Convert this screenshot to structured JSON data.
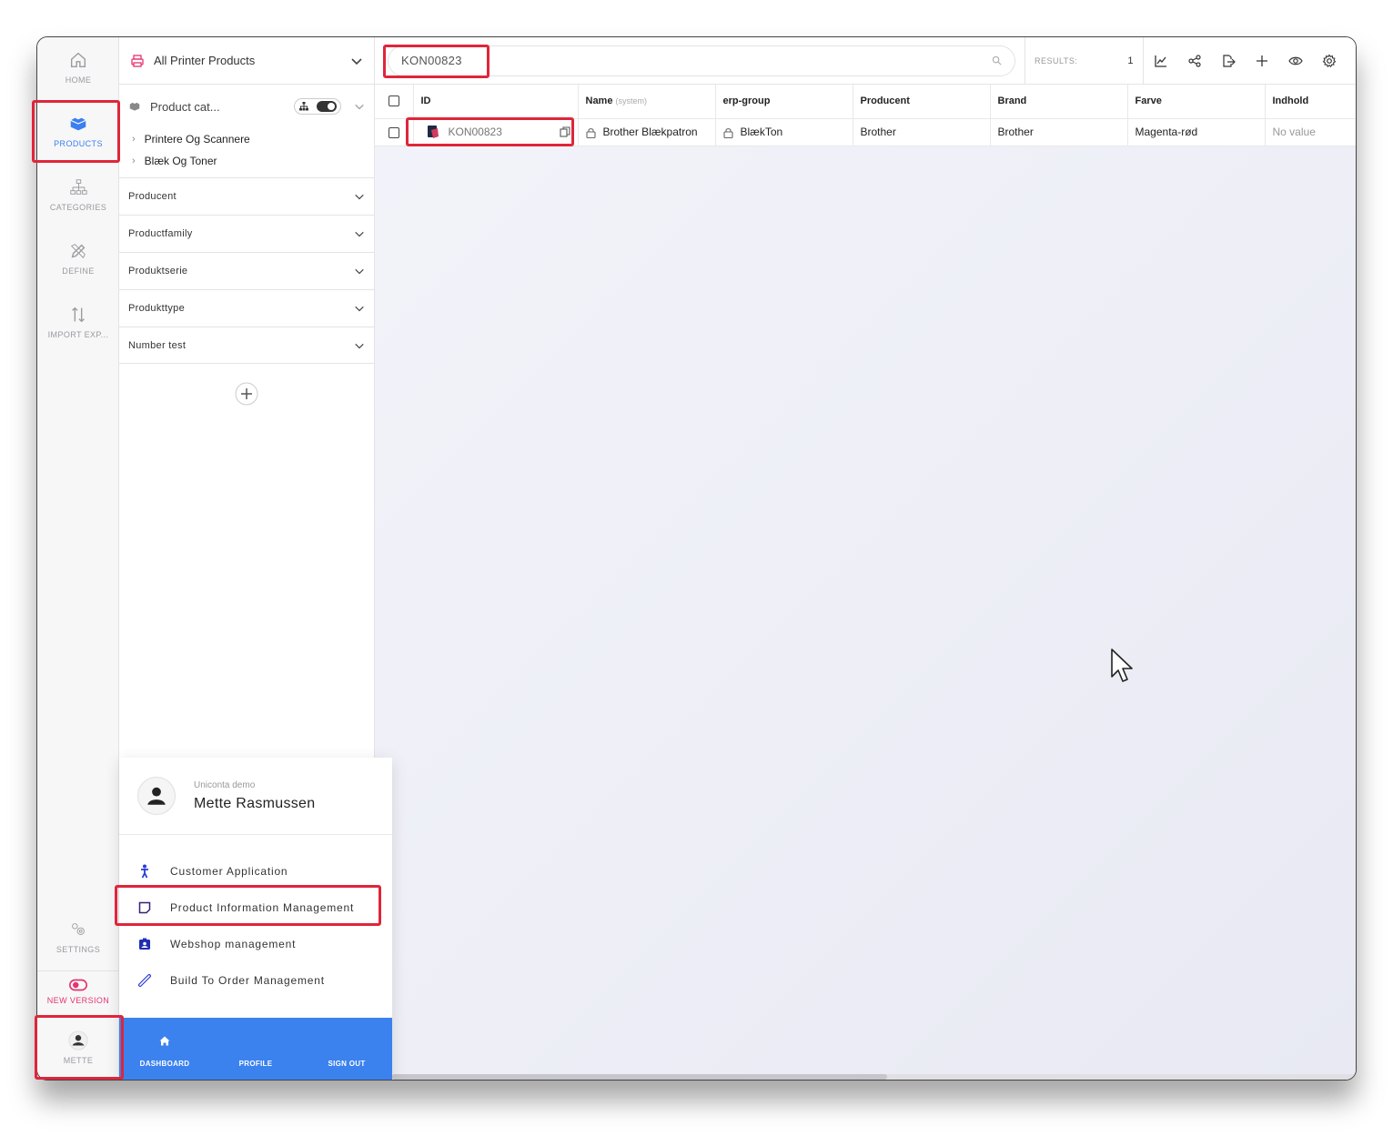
{
  "rail": {
    "home": "HOME",
    "products": "PRODUCTS",
    "categories": "CATEGORIES",
    "define": "DEFINE",
    "import_export": "IMPORT EXP...",
    "settings": "SETTINGS",
    "new_version": "NEW VERSION",
    "user": "METTE"
  },
  "filter": {
    "header_title": "All Printer Products",
    "category_label": "Product cat...",
    "tree": [
      "Printere Og Scannere",
      "Blæk Og Toner"
    ],
    "facets": [
      "Producent",
      "Productfamily",
      "Produktserie",
      "Produkttype",
      "Number test"
    ]
  },
  "search": {
    "value": "KON00823"
  },
  "results": {
    "label": "RESULTS:",
    "count": "1"
  },
  "table": {
    "headers": {
      "id": "ID",
      "name": "Name",
      "name_sub": "(system)",
      "erp": "erp-group",
      "producent": "Producent",
      "brand": "Brand",
      "farve": "Farve",
      "indhold": "Indhold"
    },
    "row": {
      "id": "KON00823",
      "name": "Brother Blækpatron",
      "erp": "BlækTon",
      "producent": "Brother",
      "brand": "Brother",
      "farve": "Magenta-rød",
      "indhold": "No value"
    }
  },
  "popup": {
    "org": "Uniconta demo",
    "user_name": "Mette Rasmussen",
    "apps": [
      "Customer Application",
      "Product Information Management",
      "Webshop management",
      "Build To Order Management"
    ],
    "footer": {
      "dashboard": "DASHBOARD",
      "profile": "PROFILE",
      "sign_out": "SIGN OUT"
    }
  },
  "colors": {
    "accent": "#3b82ee",
    "highlight": "#e0253a",
    "pink": "#e53470"
  }
}
